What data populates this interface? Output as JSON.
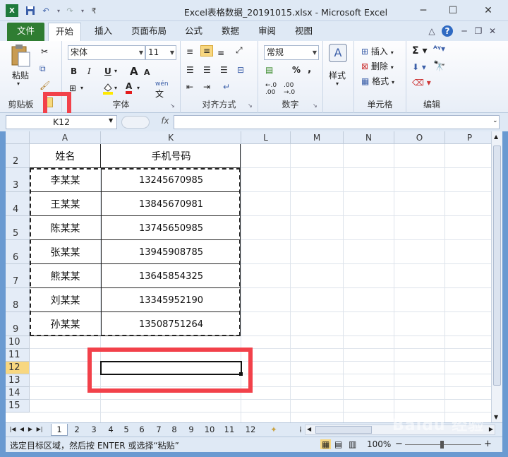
{
  "window": {
    "title": "Excel表格数据_20191015.xlsx  -  Microsoft Excel",
    "controls": {
      "minimize": "─",
      "maximize": "☐",
      "close": "✕"
    }
  },
  "quick_access": {
    "icons": [
      "excel-logo-icon",
      "save-icon",
      "undo-icon",
      "redo-icon",
      "customize-icon"
    ]
  },
  "tabs": [
    "文件",
    "开始",
    "插入",
    "页面布局",
    "公式",
    "数据",
    "审阅",
    "视图"
  ],
  "ribbon": {
    "clipboard": {
      "label": "剪贴板",
      "paste": "粘贴"
    },
    "font": {
      "label": "字体",
      "name": "宋体",
      "size": "11",
      "bold": "B",
      "italic": "I",
      "underline": "U",
      "grow": "A",
      "shrink": "A",
      "color_a": "A",
      "wen": "wén",
      "wen2": "文"
    },
    "alignment": {
      "label": "对齐方式"
    },
    "number": {
      "label": "数字",
      "format": "常规",
      "percent": "%",
      "comma": ",",
      "inc": "+.0\n.00",
      "dec": ".00\n+.0"
    },
    "styles": {
      "label": "样式"
    },
    "cells": {
      "label": "单元格",
      "insert": "插入",
      "delete": "删除",
      "format": "格式"
    },
    "editing": {
      "label": "编辑"
    }
  },
  "formula_bar": {
    "name_box": "K12",
    "fx": "fx",
    "formula": ""
  },
  "columns": [
    "A",
    "K",
    "L",
    "M",
    "N",
    "O",
    "P"
  ],
  "rows": [
    "2",
    "3",
    "4",
    "5",
    "6",
    "7",
    "8",
    "9",
    "10",
    "11",
    "12",
    "13",
    "14",
    "15"
  ],
  "table": {
    "header": [
      "姓名",
      "手机号码"
    ],
    "rows": [
      [
        "李某某",
        "13245670985"
      ],
      [
        "王某某",
        "13845670981"
      ],
      [
        "陈某某",
        "13745650985"
      ],
      [
        "张某某",
        "13945908785"
      ],
      [
        "熊某某",
        "13645854325"
      ],
      [
        "刘某某",
        "13345952190"
      ],
      [
        "孙某某",
        "13508751264"
      ]
    ]
  },
  "sheet_tabs": [
    "1",
    "2",
    "3",
    "4",
    "5",
    "6",
    "7",
    "8",
    "9",
    "10",
    "11",
    "12"
  ],
  "status": {
    "text": "选定目标区域，然后按 ENTER 或选择“粘贴”",
    "zoom": "100%",
    "minus": "−",
    "plus": "+",
    "watermark": "Baidu 经验"
  },
  "colors": {
    "file_tab": "#2f7d32",
    "selected_row_header": "#f8d780",
    "highlight_red": "#f2414a"
  }
}
